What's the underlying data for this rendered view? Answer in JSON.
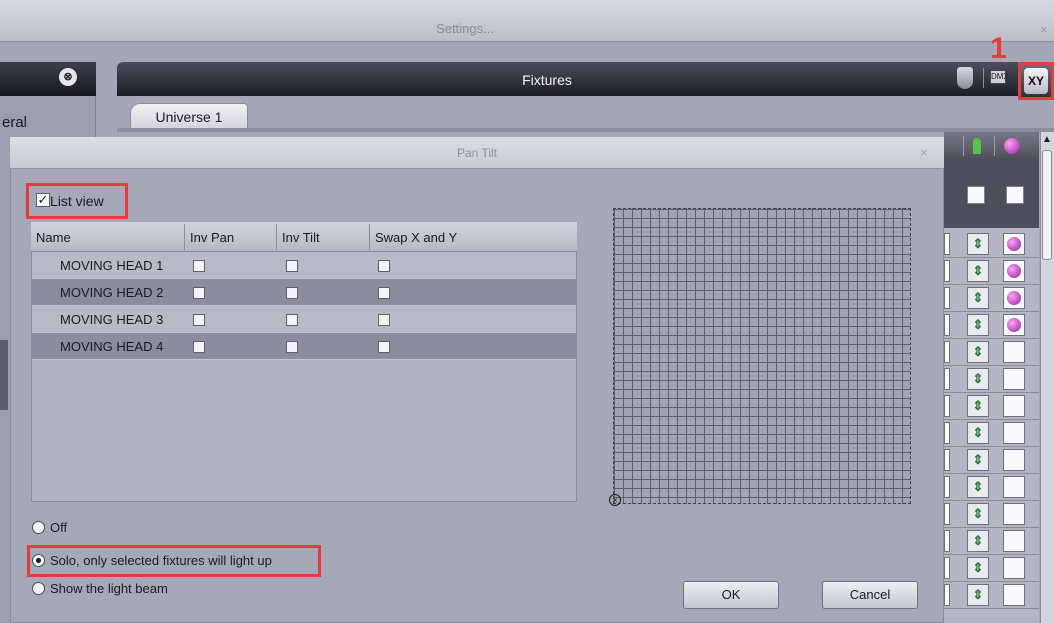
{
  "window": {
    "title": "Settings...",
    "close": "×"
  },
  "left": {
    "collapse_glyph": "⊗",
    "section_label": "eral"
  },
  "fixtures": {
    "title": "Fixtures",
    "dmx_icon_text": "DMX",
    "xy_button_label": "XY",
    "annotation_number": "1",
    "tabs": [
      {
        "label": "Universe 1"
      }
    ]
  },
  "dialog": {
    "title": "Pan Tilt",
    "close": "×",
    "list_view_label": "List view",
    "list_view_checked": true,
    "columns": [
      "Name",
      "Inv Pan",
      "Inv Tilt",
      "Swap X and Y"
    ],
    "rows": [
      {
        "name": "MOVING HEAD  1"
      },
      {
        "name": "MOVING HEAD  2"
      },
      {
        "name": "MOVING HEAD  3"
      },
      {
        "name": "MOVING HEAD  4"
      }
    ],
    "radio_options": [
      {
        "label": "Off",
        "selected": false
      },
      {
        "label": "Solo, only selected fixtures will light up",
        "selected": true
      },
      {
        "label": "Show the light beam",
        "selected": false
      }
    ],
    "ok_label": "OK",
    "cancel_label": "Cancel"
  },
  "colors": {
    "highlight": "#e83b3b",
    "accent_green": "#5cc14c",
    "accent_purple": "#9e1aa0"
  },
  "icons": [
    "collapse-up-icon",
    "light-fixture-icon",
    "dmx-icon",
    "xy-icon",
    "green-fixture-icon",
    "purple-color-icon",
    "close-icon"
  ]
}
